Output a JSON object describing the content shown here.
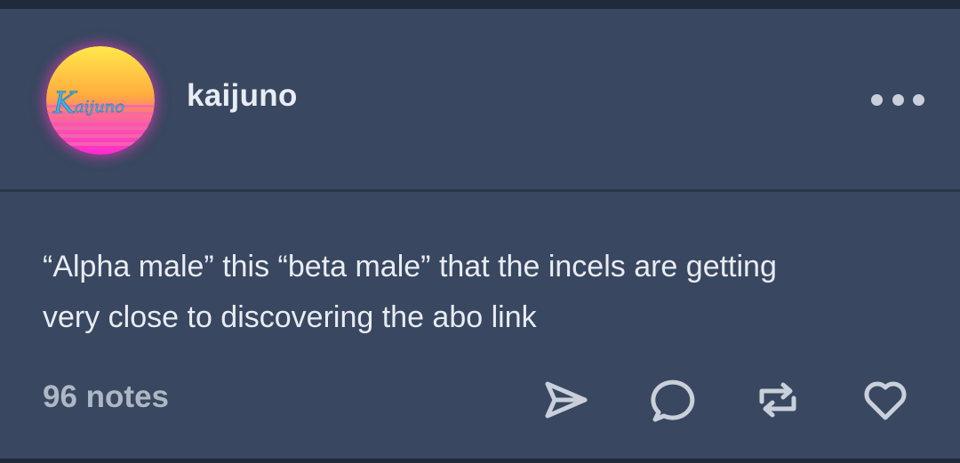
{
  "post": {
    "username": "kaijuno",
    "avatar_text": "Kaijuno",
    "body_lines": [
      "“Alpha male” this “beta male” that the incels are getting",
      "very close to discovering the abo link"
    ],
    "notes_label": "96 notes"
  },
  "actions": {
    "icons": [
      "more-options-icon",
      "share-icon",
      "reply-icon",
      "reblog-icon",
      "like-icon"
    ]
  },
  "colors": {
    "page_background": "#1f2a3a",
    "card_background": "#394760",
    "text_primary": "#e8ecf3",
    "text_secondary": "#aeb7c4",
    "icon_color": "#c9d0da"
  }
}
